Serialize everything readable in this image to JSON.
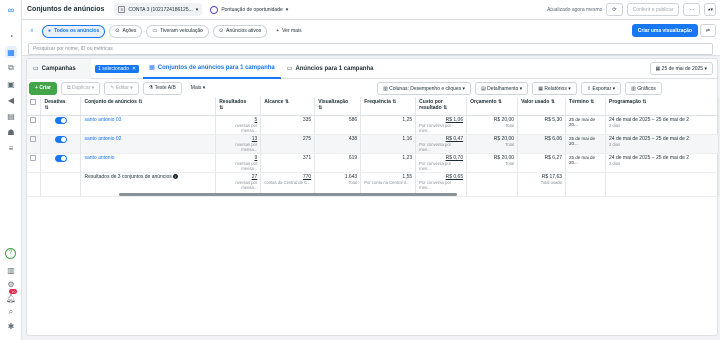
{
  "app": {
    "title": "Conjuntos de anúncios",
    "account": "CONTA 3 (1021724186125...",
    "opportunity": "Pontuação de oportunidade",
    "updated": "Atualizado agora mesmo",
    "discard": "Descartar rascunhos",
    "confirm": "Conferir e publicar"
  },
  "filters": {
    "pills": [
      "Todos os anúncios",
      "Ações",
      "Tiveram veiculação",
      "Anúncios ativos"
    ],
    "see_more": "Ver mais",
    "create_view": "Criar uma visualização",
    "search_placeholder": "Pesquisar por nome, ID ou métricas"
  },
  "tabs": {
    "campaigns": "Campanhas",
    "selected": "1 selecionado",
    "adsets": "Conjuntos de anúncios para 1 campanha",
    "ads": "Anúncios para 1 campanha"
  },
  "toolbar": {
    "create": "Criar",
    "duplicate": "Duplicar",
    "edit": "Editar",
    "ab_test": "Teste A/B",
    "more": "Mais",
    "columns": "Colunas: Desempenho e cliques",
    "breakdown": "Detalhamento",
    "reports": "Relatórios",
    "export": "Exportar",
    "charts": "Gráficos",
    "date": "25 de mai de 2025"
  },
  "headers": {
    "active": "Desativa",
    "name": "Conjunto de anúncios",
    "results": "Resultados",
    "reach": "Alcance",
    "impressions": "Visualização",
    "frequency": "Frequência",
    "cost": "Custo por resultado",
    "budget": "Orçamento",
    "spent": "Valor usado",
    "ends": "Término",
    "schedule": "Programação"
  },
  "rows": [
    {
      "name": "santo antonio 03",
      "results": "5",
      "results_sub": "nversas por mensa...",
      "reach": "335",
      "views": "586",
      "freq": "1,25",
      "cost": "R$ 1,06",
      "cost_sub": "Por conversa por men...",
      "budget": "R$ 20,00",
      "budget_sub": "Total",
      "spent": "R$ 5,30",
      "ends": "25 de mai de 20...",
      "schedule": "24 de mai de 2025 – 25 de mai de 2",
      "schedule_sub": "2 dias"
    },
    {
      "name": "santo antonio 02",
      "results": "13",
      "results_sub": "nversas por mensa...",
      "reach": "275",
      "views": "438",
      "freq": "1,16",
      "cost": "R$ 0,47",
      "cost_sub": "Por conversa por men...",
      "budget": "R$ 20,00",
      "budget_sub": "Total",
      "spent": "R$ 6,06",
      "ends": "25 de mai de 20...",
      "schedule": "24 de mai de 2025 – 25 de mai de 2",
      "schedule_sub": "2 dias"
    },
    {
      "name": "santo antonio",
      "results": "9",
      "results_sub": "nversas por mensa...",
      "reach": "371",
      "views": "619",
      "freq": "1,23",
      "cost": "R$ 0,70",
      "cost_sub": "Por conversa por men...",
      "budget": "R$ 20,00",
      "budget_sub": "Total",
      "spent": "R$ 6,27",
      "ends": "25 de mai de 20...",
      "schedule": "24 de mai de 2025 – 25 de mai de 2",
      "schedule_sub": "2 dias"
    }
  ],
  "totals": {
    "label": "Resultados de 3 conjuntos de anúncios",
    "results": "27",
    "results_sub": "nversas por mensa...",
    "reach": "770",
    "reach_sub": "contas da Central de C...",
    "views": "1.643",
    "views_sub": "Total",
    "freq": "1,55",
    "freq_sub": "Por conta na Central d...",
    "cost": "R$ 0,65",
    "cost_sub": "Por conversa por men...",
    "spent": "R$ 17,63",
    "spent_sub": "Total usado"
  },
  "notifications": "10"
}
